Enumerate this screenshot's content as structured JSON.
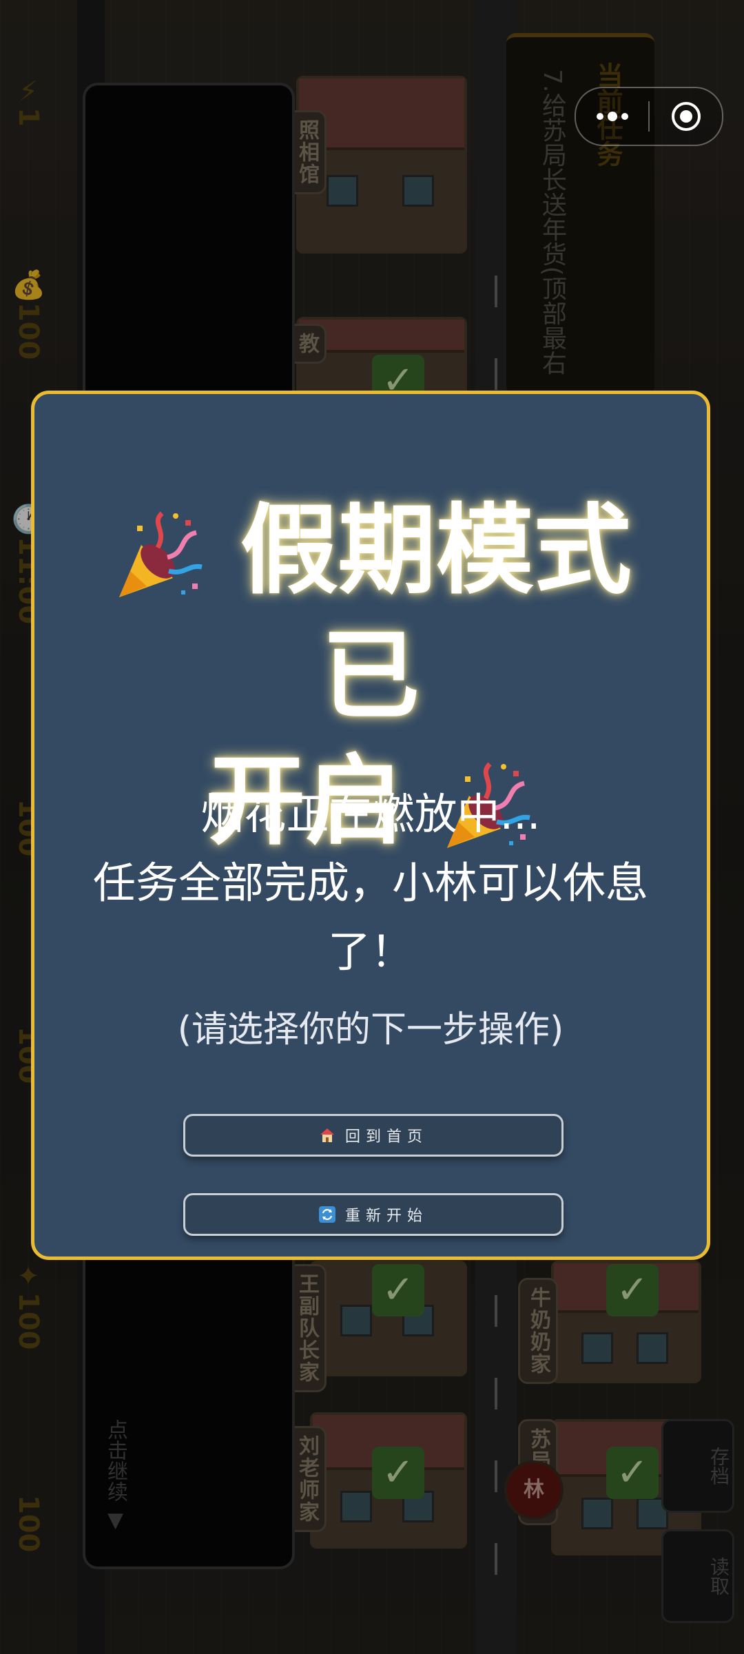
{
  "hud": {
    "energy": "⚡1",
    "money": "💰100",
    "time": "🕐11:00",
    "stat3": "100",
    "stat4": "100",
    "stat5": "✦100",
    "stat6": "100"
  },
  "task_panel": {
    "title": "当前任务",
    "description": "7.给苏局长送年货(顶部最右"
  },
  "map": {
    "labels": [
      "照相馆",
      "教",
      "王副队长家",
      "刘老师家",
      "苏局长家",
      "牛奶奶家"
    ],
    "avatar": "林",
    "hint": "点击继续 ▼"
  },
  "side_buttons": {
    "save": "存档",
    "load": "读取"
  },
  "modal": {
    "title_line1": "假期模式已",
    "title_line2": "开启",
    "body_line1": "烟花正在燃放中...",
    "body_line2": "任务全部完成，小林可以休息",
    "body_line3": "了！",
    "hint": "(请选择你的下一步操作)",
    "btn_home": "回到首页",
    "btn_restart": "重新开始"
  },
  "colors": {
    "modal_bg": "#344a62",
    "modal_border": "#e9bd2f",
    "title_glow": "#ffec96",
    "button_bg": "#2f4256"
  },
  "icons": [
    "party-popper-icon",
    "home-icon",
    "restart-icon",
    "more-dots-icon",
    "target-icon"
  ]
}
